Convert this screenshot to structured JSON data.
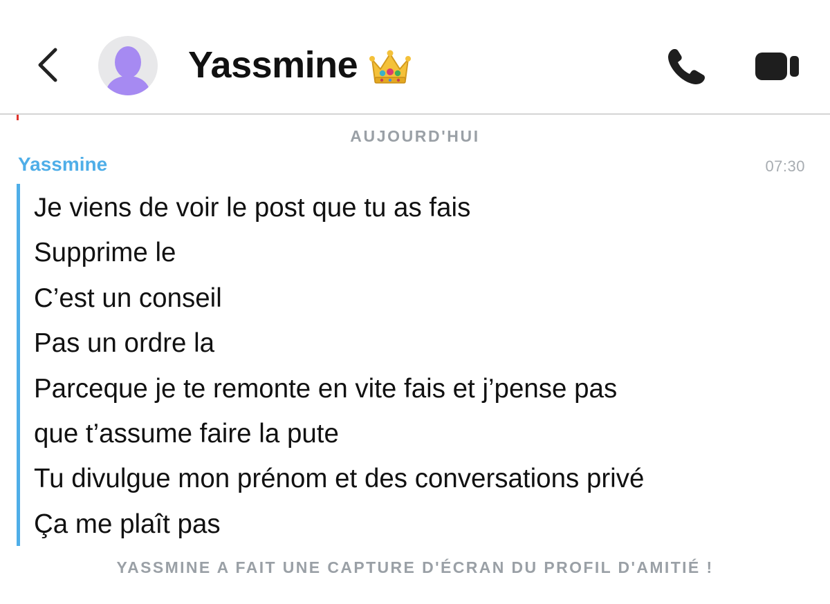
{
  "header": {
    "contact_name": "Yassmine",
    "name_emoji": "crown",
    "icons": {
      "back": "chevron-left-icon",
      "avatar": "user-silhouette-icon",
      "call": "phone-icon",
      "video": "video-camera-icon"
    },
    "colors": {
      "avatar_bg": "#e8e8ea",
      "avatar_figure": "#a68af2"
    }
  },
  "chat": {
    "day_label": "AUJOURD'HUI",
    "message": {
      "sender": "Yassmine",
      "time": "07:30",
      "lines": [
        "Je viens de voir le post que tu as fais",
        "Supprime le",
        "C’est un conseil",
        "Pas un ordre la",
        "Parceque je te remonte en vite fais et j’pense pas",
        "que t’assume faire la pute",
        "Tu divulgue mon prénom et des conversations privé",
        "Ça me plaît pas"
      ]
    },
    "system_notice": "YASSMINE A FAIT UNE CAPTURE D'ÉCRAN DU PROFIL D'AMITIÉ !",
    "colors": {
      "accent": "#4faee8",
      "muted": "#9aa0a6"
    }
  }
}
